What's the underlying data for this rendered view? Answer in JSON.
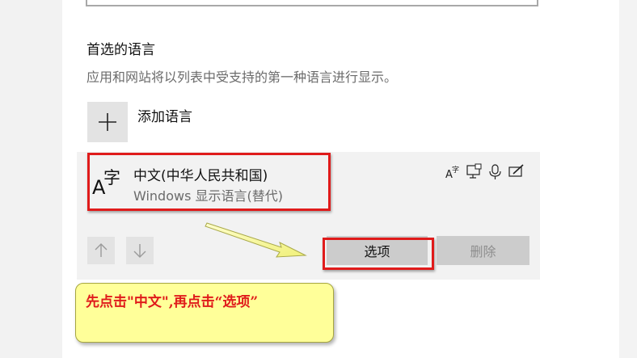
{
  "preferred_languages": {
    "title": "首选的语言",
    "description": "应用和网站将以列表中受支持的第一种语言进行显示。",
    "add_language_label": "添加语言"
  },
  "language_item": {
    "name": "中文(中华人民共和国)",
    "subtitle": "Windows 显示语言(替代)",
    "glyph_letter": "A",
    "glyph_char": "字",
    "feature_icons": [
      "language-pack-icon",
      "display-language-icon",
      "speech-icon",
      "handwriting-icon"
    ]
  },
  "buttons": {
    "options": "选项",
    "remove": "删除",
    "move_up_icon": "arrow-up-icon",
    "move_down_icon": "arrow-down-icon"
  },
  "annotation": {
    "text": "先点击\"中文\",再点击“选项”",
    "highlight_color": "#e01b1b",
    "note_color": "#ffff99"
  }
}
